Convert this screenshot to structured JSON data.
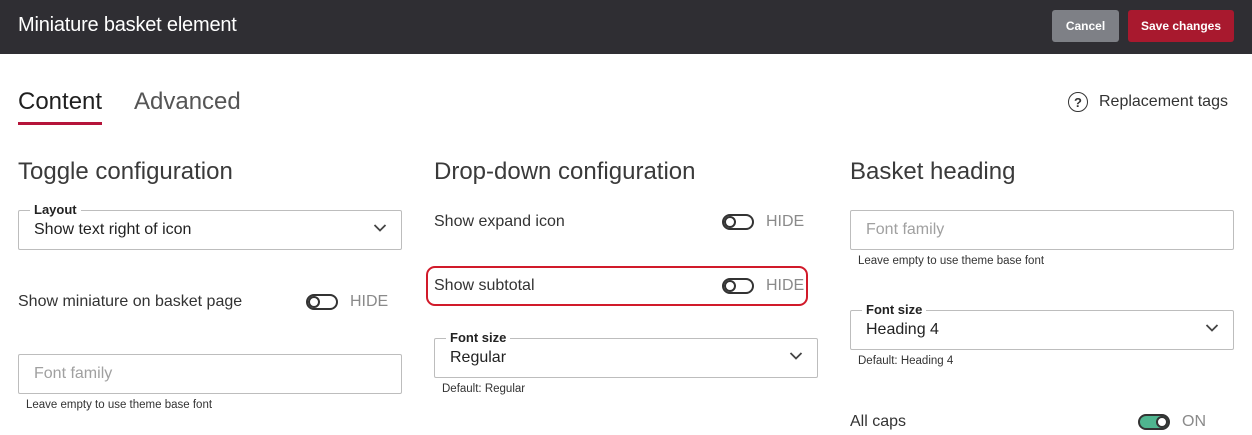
{
  "header": {
    "title": "Miniature basket element",
    "cancel_label": "Cancel",
    "save_label": "Save changes"
  },
  "tabs": {
    "content": "Content",
    "advanced": "Advanced",
    "active": "Content"
  },
  "replacement_tags": {
    "icon": "question-circle-icon",
    "label": "Replacement tags"
  },
  "toggle_config": {
    "heading": "Toggle configuration",
    "layout": {
      "label": "Layout",
      "value": "Show text right of icon"
    },
    "show_miniature": {
      "label": "Show miniature on basket page",
      "state": "HIDE",
      "on": false
    },
    "font_family": {
      "placeholder": "Font family",
      "hint": "Leave empty to use theme base font"
    }
  },
  "dropdown_config": {
    "heading": "Drop-down configuration",
    "show_expand_icon": {
      "label": "Show expand icon",
      "state": "HIDE",
      "on": false
    },
    "show_subtotal": {
      "label": "Show subtotal",
      "state": "HIDE",
      "on": false
    },
    "font_size": {
      "label": "Font size",
      "value": "Regular",
      "hint": "Default: Regular"
    }
  },
  "basket_heading": {
    "heading": "Basket heading",
    "font_family": {
      "placeholder": "Font family",
      "hint": "Leave empty to use theme base font"
    },
    "font_size": {
      "label": "Font size",
      "value": "Heading 4",
      "hint": "Default: Heading 4"
    },
    "all_caps": {
      "label": "All caps",
      "state": "ON",
      "on": true
    }
  },
  "colors": {
    "topbar_bg": "#2f2e33",
    "cancel_bg": "#7e8086",
    "save_bg": "#a8192e",
    "tab_accent": "#b5143a",
    "toggle_on": "#4fb58f",
    "highlight_border": "#d11a2a"
  }
}
